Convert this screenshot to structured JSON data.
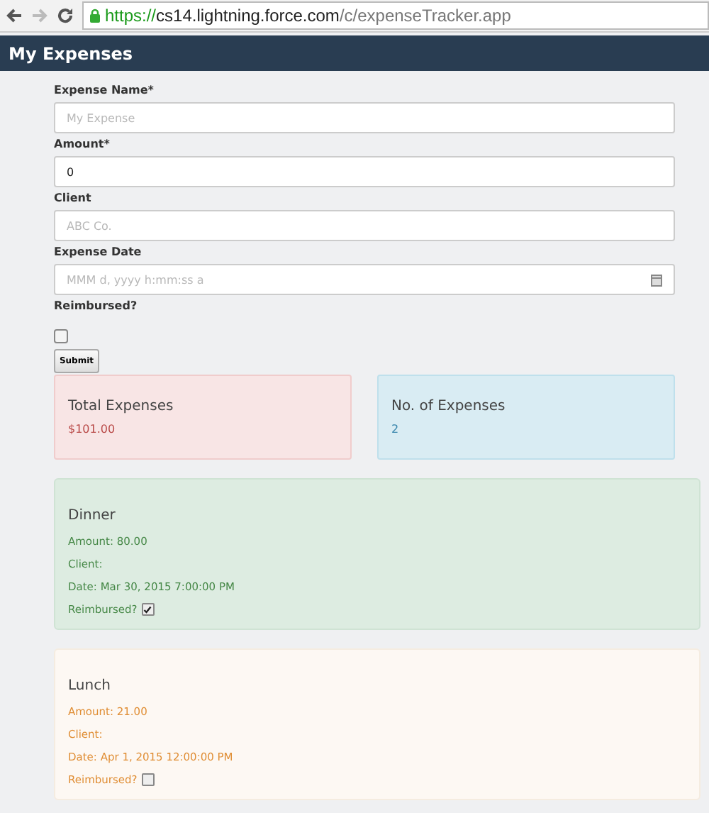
{
  "browser": {
    "url": {
      "scheme": "https://",
      "host": "cs14.lightning.force.com",
      "path": "/c/expenseTracker.app"
    }
  },
  "header": {
    "title": "My Expenses"
  },
  "form": {
    "fields": [
      {
        "kind": "text",
        "label": "Expense Name*",
        "placeholder": "My Expense"
      },
      {
        "kind": "text",
        "label": "Amount*",
        "value": "0"
      },
      {
        "kind": "text",
        "label": "Client",
        "placeholder": "ABC Co."
      },
      {
        "kind": "date",
        "label": "Expense Date",
        "placeholder": "MMM d, yyyy h:mm:ss a"
      },
      {
        "kind": "checkbox",
        "label": "Reimbursed?",
        "checked": false
      }
    ],
    "submit": "Submit"
  },
  "summary": [
    {
      "kind": "total",
      "title": "Total Expenses",
      "value": "$101.00"
    },
    {
      "kind": "count",
      "title": "No. of Expenses",
      "value": "2"
    }
  ],
  "expenses": [
    {
      "name": "Dinner",
      "amount": "Amount: 80.00",
      "client": "Client:",
      "date": "Date: Mar 30, 2015 7:00:00 PM",
      "reimbursed_label": "Reimbursed?",
      "reimbursed": true
    },
    {
      "name": "Lunch",
      "amount": "Amount: 21.00",
      "client": "Client:",
      "date": "Date: Apr 1, 2015 12:00:00 PM",
      "reimbursed_label": "Reimbursed?",
      "reimbursed": false
    }
  ]
}
